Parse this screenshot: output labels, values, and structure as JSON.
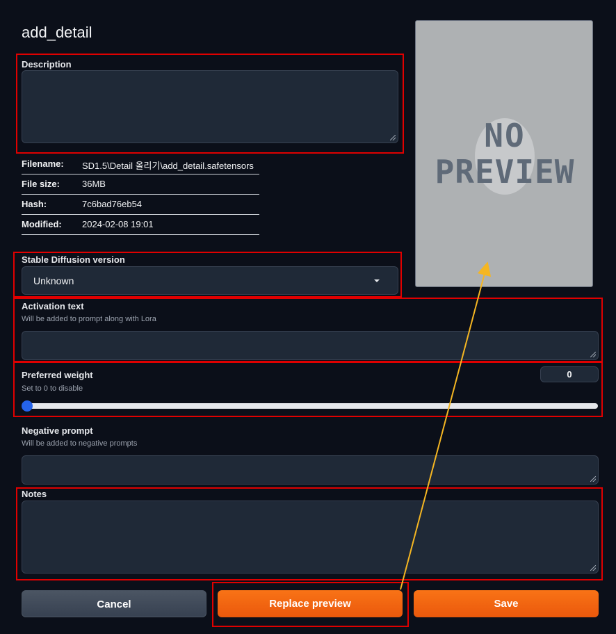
{
  "title": "add_detail",
  "description": {
    "label": "Description",
    "value": ""
  },
  "info": [
    {
      "key": "Filename:",
      "value": "SD1.5\\Detail 올리기\\add_detail.safetensors"
    },
    {
      "key": "File size:",
      "value": "36MB"
    },
    {
      "key": "Hash:",
      "value": "7c6bad76eb54"
    },
    {
      "key": "Modified:",
      "value": "2024-02-08 19:01"
    }
  ],
  "sd_version": {
    "label": "Stable Diffusion version",
    "selected": "Unknown"
  },
  "activation": {
    "label": "Activation text",
    "hint": "Will be added to prompt along with Lora",
    "value": ""
  },
  "weight": {
    "label": "Preferred weight",
    "hint": "Set to 0 to disable",
    "value": "0",
    "slider_fraction": 0
  },
  "negative": {
    "label": "Negative prompt",
    "hint": "Will be added to negative prompts",
    "value": ""
  },
  "notes": {
    "label": "Notes",
    "value": ""
  },
  "buttons": {
    "cancel": "Cancel",
    "replace": "Replace preview",
    "save": "Save"
  },
  "preview": {
    "line1": "NO",
    "line2": "PREVIEW"
  },
  "colors": {
    "accent": "#f97316",
    "highlight": "#e00000",
    "arrow": "#f5b622",
    "slider": "#2563eb"
  }
}
